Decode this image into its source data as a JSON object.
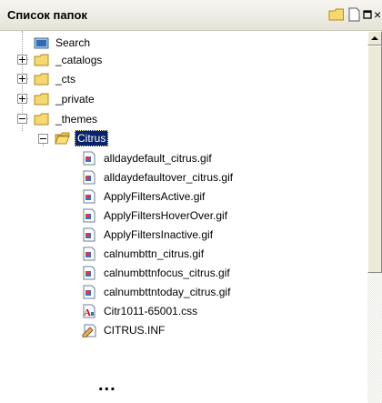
{
  "panel": {
    "title": "Список папок",
    "close_glyph": "×"
  },
  "tree": {
    "search": "Search",
    "catalogs": "_catalogs",
    "cts": "_cts",
    "private": "_private",
    "themes": "_themes",
    "citrus": "Citrus",
    "files": [
      "alldaydefault_citrus.gif",
      "alldaydefaultover_citrus.gif",
      "ApplyFiltersActive.gif",
      "ApplyFiltersHoverOver.gif",
      "ApplyFiltersInactive.gif",
      "calnumbttn_citrus.gif",
      "calnumbttnfocus_citrus.gif",
      "calnumbttntoday_citrus.gif"
    ],
    "css_file": "Citr1011-65001.css",
    "inf_file": "CITRUS.INF",
    "ellipsis": "..."
  },
  "colors": {
    "folder": "#f5d86e",
    "selection": "#0a246a"
  }
}
